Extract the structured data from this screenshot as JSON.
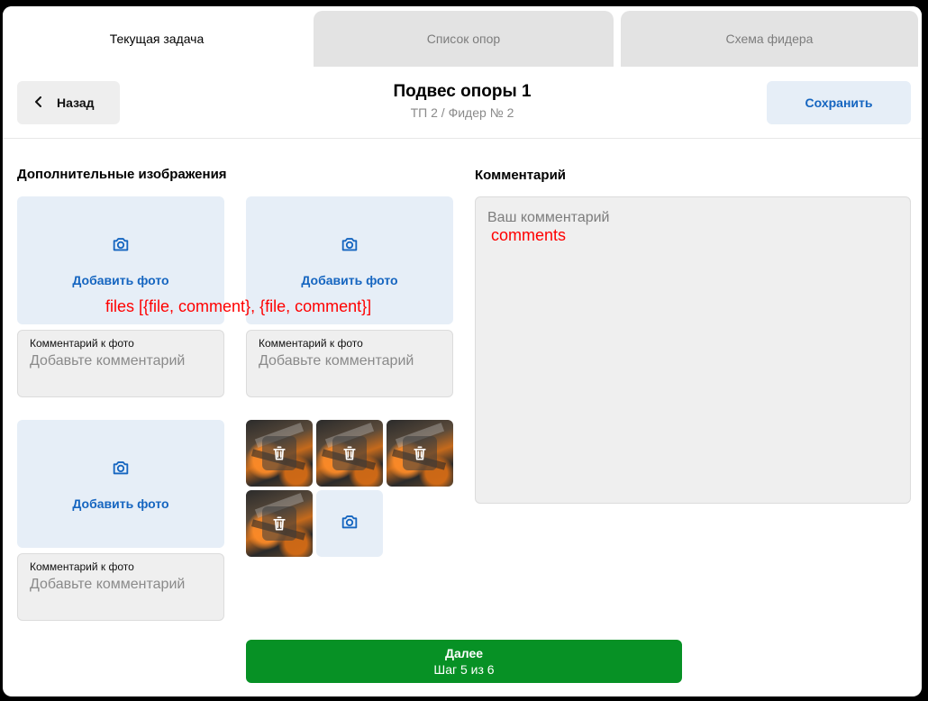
{
  "tabs": [
    {
      "label": "Текущая задача",
      "active": true
    },
    {
      "label": "Список опор",
      "active": false
    },
    {
      "label": "Схема фидера",
      "active": false
    }
  ],
  "header": {
    "back_label": "Назад",
    "title": "Подвес опоры 1",
    "subtitle": "ТП 2 / Фидер № 2",
    "save_label": "Сохранить"
  },
  "images_section": {
    "title": "Дополнительные изображения",
    "add_photo_label": "Добавить фото",
    "photo_comment_label": "Комментарий к фото",
    "photo_comment_placeholder": "Добавьте комментарий",
    "thumbnail_count": 4
  },
  "comment_section": {
    "title": "Комментарий",
    "placeholder": "Ваш комментарий"
  },
  "annotations": {
    "files": "files [{file, comment}, {file, comment}]",
    "comments": "comments"
  },
  "footer": {
    "next_label": "Далее",
    "step_label": "Шаг 5 из 6"
  },
  "colors": {
    "accent_blue": "#1565c0",
    "tile_bg": "#e6eef7",
    "next_green": "#079125",
    "annotation_red": "#ff0000"
  }
}
